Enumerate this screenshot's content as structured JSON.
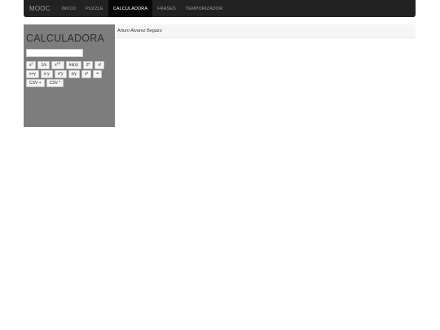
{
  "navbar": {
    "brand": "MOOC",
    "items": [
      {
        "label": "INICIO",
        "active": false
      },
      {
        "label": "PUZZLE",
        "active": false
      },
      {
        "label": "CALCULADORA",
        "active": true
      },
      {
        "label": "FRASES",
        "active": false
      },
      {
        "label": "TEMPORIZADOR",
        "active": false
      }
    ]
  },
  "calculator": {
    "title": "CALCULADORA",
    "display_value": "",
    "buttons_row1": [
      {
        "base": "x",
        "sup": "2"
      },
      {
        "base": "1/x",
        "sup": ""
      },
      {
        "base": "x",
        "sup": "1/2"
      },
      {
        "base": "Int(x)",
        "sup": ""
      },
      {
        "base": "2",
        "sup": "x"
      },
      {
        "base": "x!",
        "sup": ""
      }
    ],
    "buttons_row2": [
      "x+y",
      "x-y",
      "x*y",
      "x/y",
      "x",
      "="
    ],
    "button_row2_sup": "y",
    "buttons_row3": [
      "CSV +",
      "CSV *"
    ]
  },
  "main": {
    "author": "Arturo Alvarez Begazo"
  },
  "colors": {
    "navbar_bg": "#222222",
    "navbar_active_bg": "#080808",
    "sidebar_bg": "#7d7d7d",
    "panel_bg": "#f5f5f5"
  }
}
